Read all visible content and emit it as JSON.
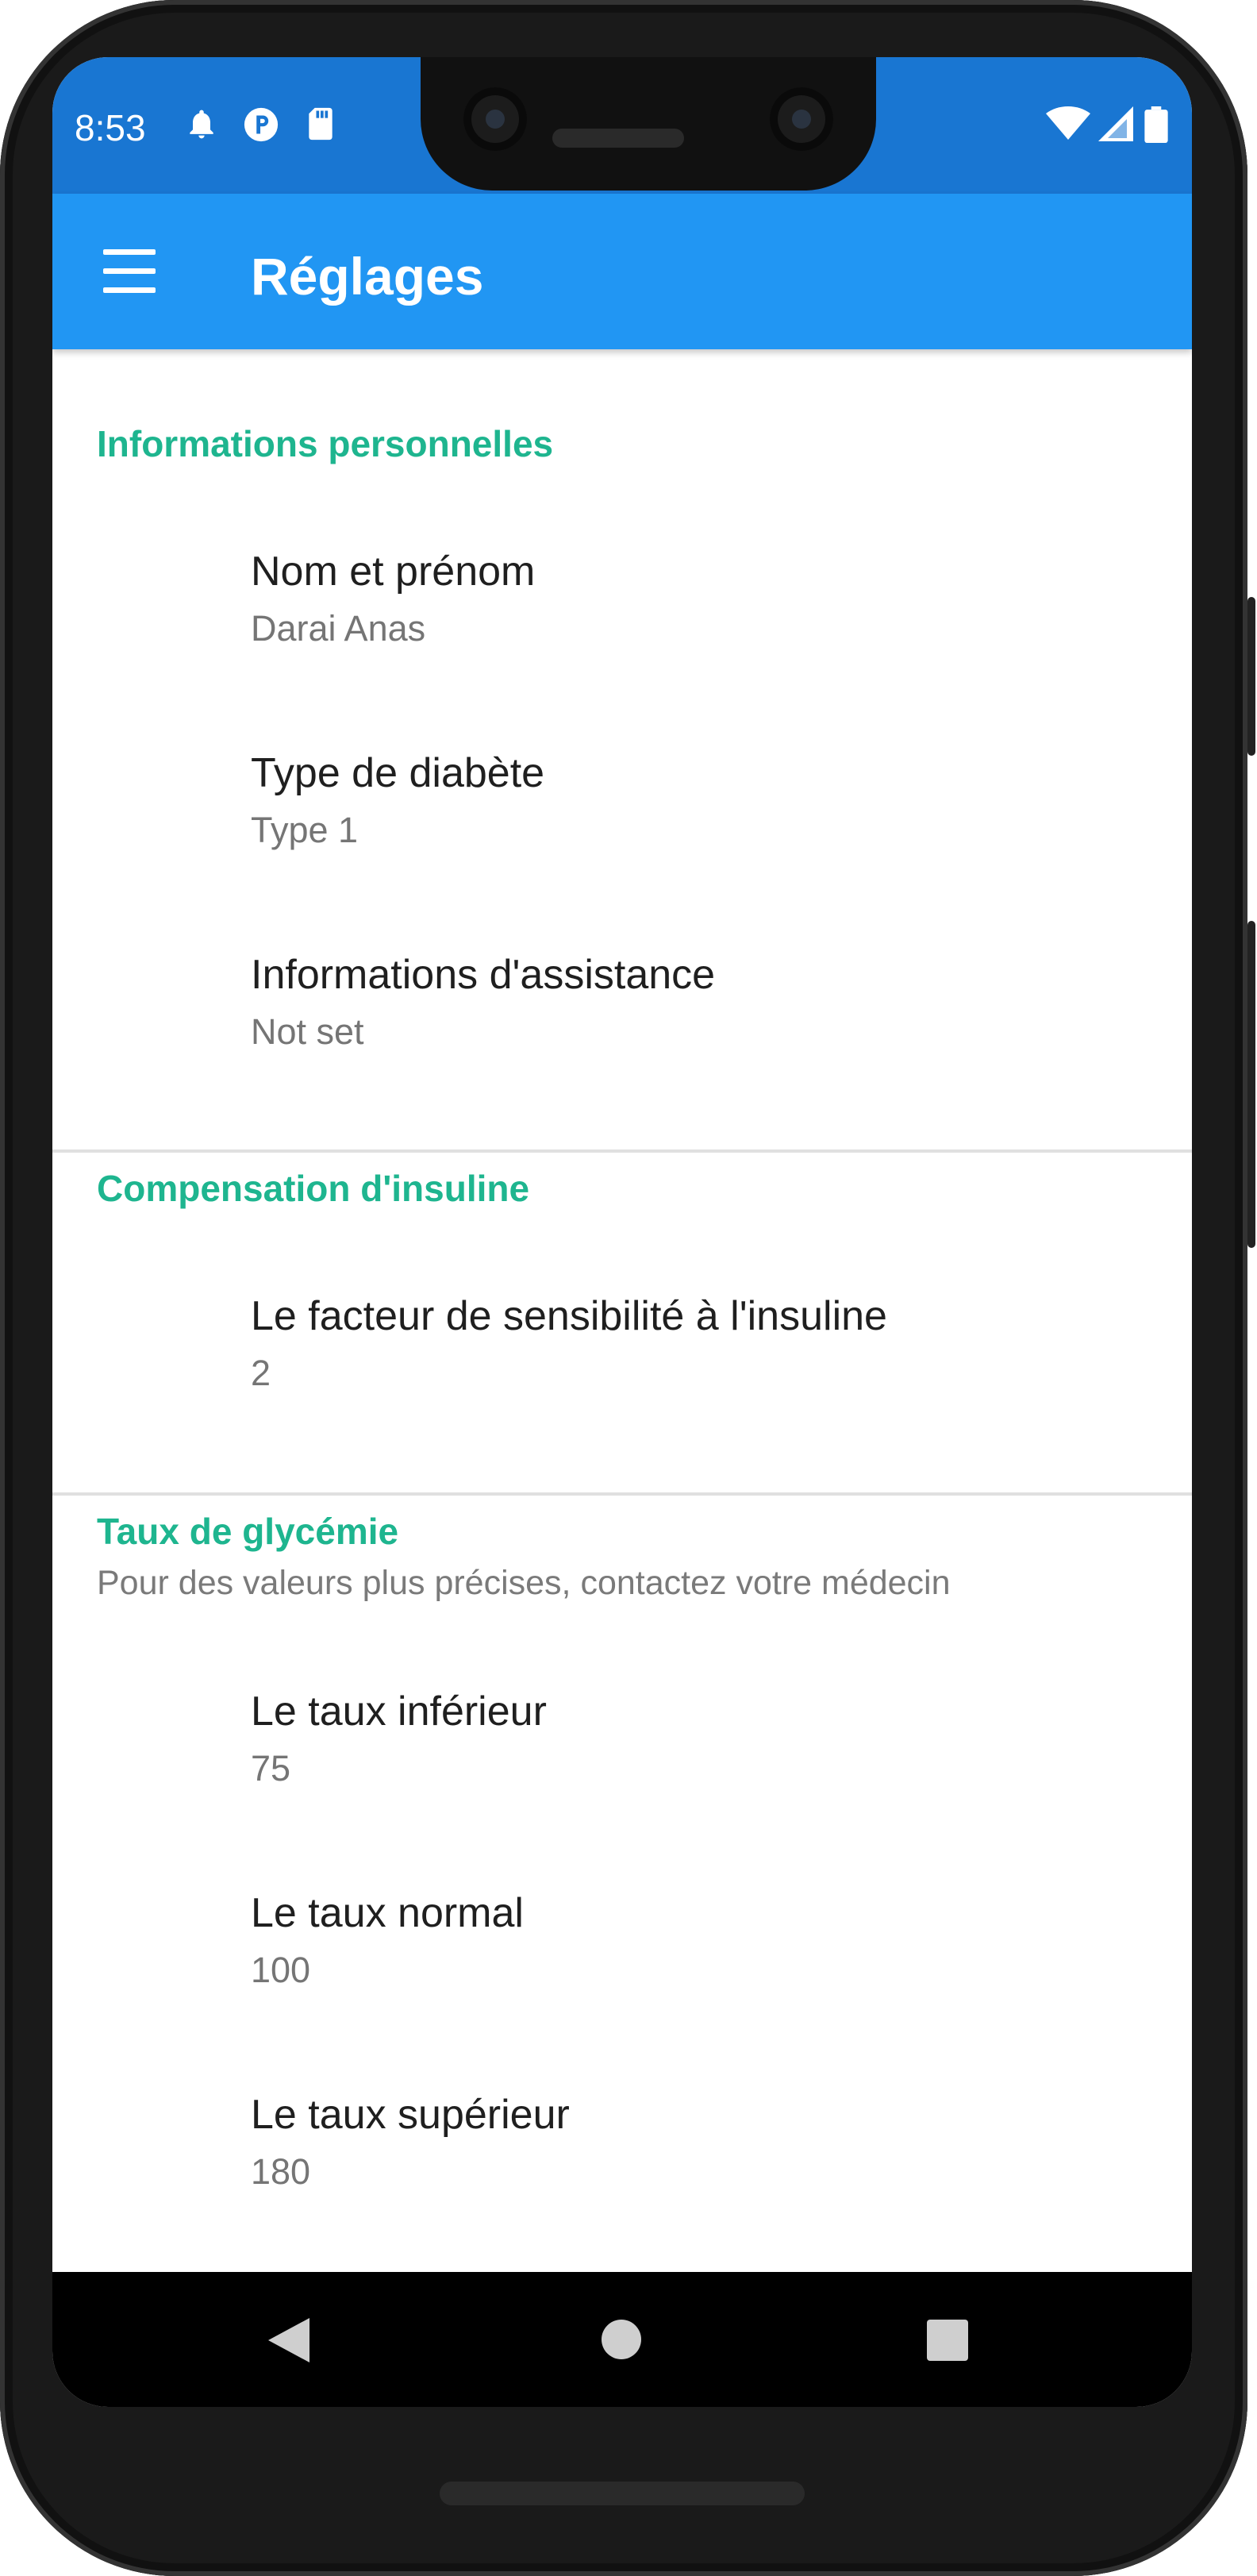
{
  "status_bar": {
    "time": "8:53",
    "left_icons": [
      "bell-icon",
      "app-p-icon",
      "sd-card-icon"
    ],
    "right_icons": [
      "wifi-icon",
      "signal-icon",
      "battery-icon"
    ]
  },
  "app_bar": {
    "title": "Réglages",
    "menu_icon": "hamburger-menu-icon"
  },
  "sections": [
    {
      "title": "Informations personnelles",
      "items": [
        {
          "title": "Nom et prénom",
          "value": "Darai Anas"
        },
        {
          "title": "Type de diabète",
          "value": "Type 1"
        },
        {
          "title": "Informations d'assistance",
          "value": "Not set"
        }
      ]
    },
    {
      "title": "Compensation d'insuline",
      "items": [
        {
          "title": "Le facteur de sensibilité à l'insuline",
          "value": "2"
        }
      ]
    },
    {
      "title": "Taux de glycémie",
      "subtitle": "Pour des valeurs plus précises, contactez votre médecin",
      "items": [
        {
          "title": "Le taux inférieur",
          "value": "75"
        },
        {
          "title": "Le taux normal",
          "value": "100"
        },
        {
          "title": "Le taux supérieur",
          "value": "180"
        }
      ]
    }
  ],
  "nav_bar": {
    "icons": [
      "back-icon",
      "home-icon",
      "recents-icon"
    ]
  },
  "colors": {
    "status_bar": "#1976D2",
    "app_bar": "#2196F3",
    "section_accent": "#1EB58F",
    "navigation_bar": "#000000"
  }
}
